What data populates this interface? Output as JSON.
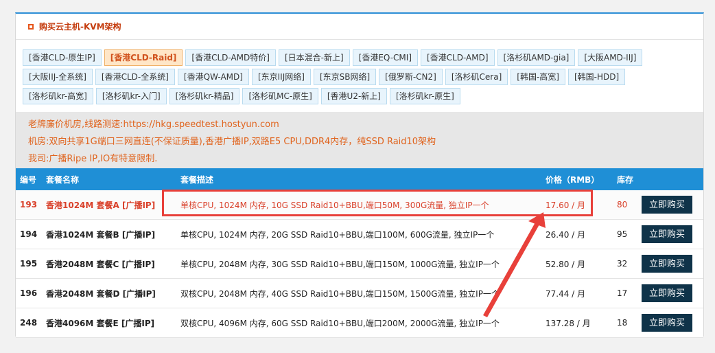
{
  "panel": {
    "title": "购买云主机-KVM架构"
  },
  "tabs": {
    "row1": [
      "[香港CLD-原生IP]",
      "[香港CLD-Raid]",
      "[香港CLD-AMD特价]",
      "[日本混合-新上]",
      "[香港EQ-CMI]",
      "[香港CLD-AMD]",
      "[洛杉矶AMD-gia]",
      "[大阪AMD-IIJ]"
    ],
    "row2": [
      "[大阪IIJ-全系统]",
      "[香港CLD-全系统]",
      "[香港QW-AMD]",
      "[东京IIJ网络]",
      "[东京SB网络]",
      "[俄罗斯-CN2]",
      "[洛杉矶Cera]",
      "[韩国-高宽]",
      "[韩国-HDD]"
    ],
    "row3": [
      "[洛杉矶kr-高宽]",
      "[洛杉矶kr-入门]",
      "[洛杉矶kr-精品]",
      "[洛杉矶MC-原生]",
      "[香港U2-新上]",
      "[洛杉矶kr-原生]"
    ],
    "active": "[香港CLD-Raid]"
  },
  "notice": {
    "line1": "老牌廉价机房,线路测速:https://hkg.speedtest.hostyun.com",
    "line2": "机房:双向共享1G端口三网直连(不保证质量),香港广播IP,双路E5 CPU,DDR4内存，纯SSD Raid10架构",
    "line3": "我司:广播Ripe IP,IO有特意限制."
  },
  "table": {
    "headers": {
      "id": "编号",
      "name": "套餐名称",
      "desc": "套餐描述",
      "price": "价格（RMB）",
      "stock": "库存"
    },
    "buy_label": "立即购买",
    "rows": [
      {
        "id": "193",
        "name": "香港1024M 套餐A [广播IP]",
        "desc": "单核CPU, 1024M 内存, 10G SSD Raid10+BBU,端口50M, 300G流量, 独立IP一个",
        "price": "17.60 / 月",
        "stock": "80"
      },
      {
        "id": "194",
        "name": "香港1024M 套餐B [广播IP]",
        "desc": "单核CPU, 1024M 内存, 20G SSD Raid10+BBU,端口100M, 600G流量, 独立IP一个",
        "price": "26.40 / 月",
        "stock": "95"
      },
      {
        "id": "195",
        "name": "香港2048M 套餐C [广播IP]",
        "desc": "单核CPU, 2048M 内存, 30G SSD Raid10+BBU,端口150M, 1000G流量, 独立IP一个",
        "price": "52.80 / 月",
        "stock": "32"
      },
      {
        "id": "196",
        "name": "香港2048M 套餐D [广播IP]",
        "desc": "双核CPU, 2048M 内存, 40G SSD Raid10+BBU,端口150M, 1500G流量, 独立IP一个",
        "price": "77.44 / 月",
        "stock": "17"
      },
      {
        "id": "248",
        "name": "香港4096M 套餐E [广播IP]",
        "desc": "双核CPU, 4096M 内存, 60G SSD Raid10+BBU,端口200M, 2000G流量, 独立IP一个",
        "price": "137.28 / 月",
        "stock": "18"
      }
    ]
  },
  "colors": {
    "accent": "#1f8fd6",
    "highlight_red": "#e8403a",
    "notice_orange": "#e0641e",
    "buy_button": "#0f3349"
  }
}
